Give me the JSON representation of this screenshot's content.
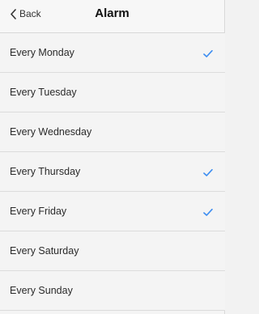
{
  "header": {
    "back_label": "Back",
    "title": "Alarm"
  },
  "days": [
    {
      "label": "Every Monday",
      "checked": true
    },
    {
      "label": "Every Tuesday",
      "checked": false
    },
    {
      "label": "Every Wednesday",
      "checked": false
    },
    {
      "label": "Every Thursday",
      "checked": true
    },
    {
      "label": "Every Friday",
      "checked": true
    },
    {
      "label": "Every Saturday",
      "checked": false
    },
    {
      "label": "Every Sunday",
      "checked": false
    }
  ],
  "colors": {
    "accent": "#3b8cf1",
    "background": "#f4f4f4",
    "separator": "#dcdcdc"
  },
  "icons": {
    "back": "chevron-left-icon",
    "selected": "checkmark-icon"
  }
}
